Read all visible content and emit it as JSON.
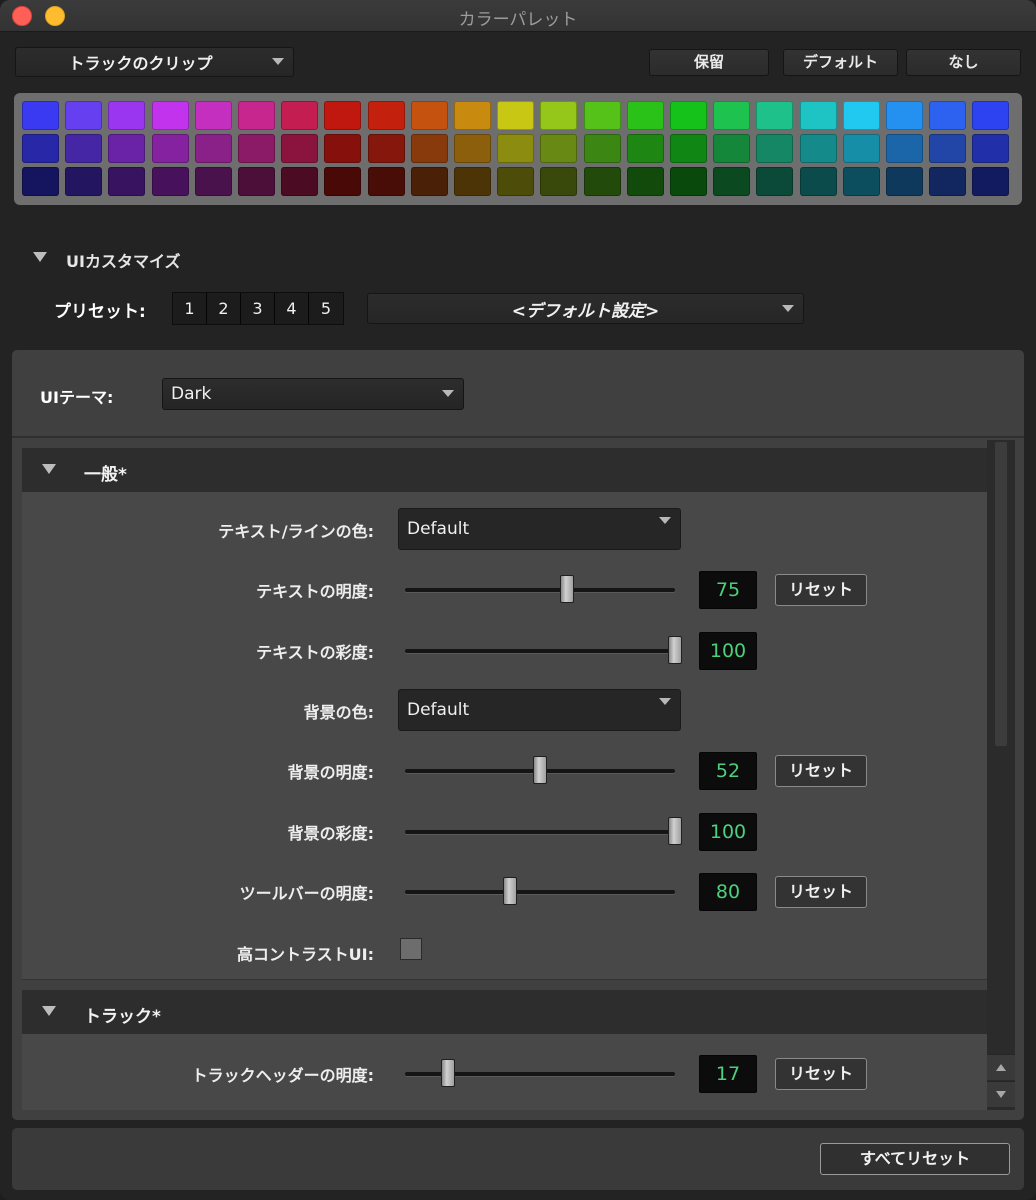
{
  "window": {
    "title": "カラーパレット"
  },
  "toolbar": {
    "clip_combo": "トラックのクリップ",
    "hold_label": "保留",
    "default_label": "デフォルト",
    "none_label": "なし"
  },
  "palette": {
    "rows": [
      [
        "#3a3af2",
        "#6640f0",
        "#9a36f0",
        "#c233ee",
        "#c52fbf",
        "#c8268f",
        "#c31d52",
        "#c0170f",
        "#c3200e",
        "#c5530f",
        "#c88a0f",
        "#c8c814",
        "#95c71a",
        "#55c21a",
        "#2ac218",
        "#15c21a",
        "#1ec24f",
        "#1ec18a",
        "#1ec3c3",
        "#21c9f0",
        "#2490f0",
        "#2d62f0",
        "#2d43f2"
      ],
      [
        "#2727a8",
        "#4527a6",
        "#6a22a6",
        "#84229f",
        "#8a2188",
        "#8b1b66",
        "#8a143d",
        "#86110c",
        "#86170c",
        "#883a0c",
        "#8b5f0c",
        "#8c8c10",
        "#688a14",
        "#3c8714",
        "#1e8713",
        "#108714",
        "#15873a",
        "#158764",
        "#158a8a",
        "#178ea8",
        "#1a66a8",
        "#2146a8",
        "#2130a8"
      ],
      [
        "#15145e",
        "#241560",
        "#371360",
        "#47125b",
        "#4a124c",
        "#4b0f39",
        "#4b0b22",
        "#490907",
        "#490d07",
        "#4a2007",
        "#4c3407",
        "#4d4d09",
        "#39490b",
        "#214a0b",
        "#114a0b",
        "#09490b",
        "#0b4a20",
        "#0b4a38",
        "#0b4b4b",
        "#0c4e5d",
        "#0f385d",
        "#122760",
        "#121b5f"
      ]
    ]
  },
  "ui_customize": {
    "header": "UIカスタマイズ",
    "preset_label": "プリセット:",
    "preset_buttons": [
      "1",
      "2",
      "3",
      "4",
      "5"
    ],
    "preset_value": "<デフォルト設定>"
  },
  "theme": {
    "label": "UIテーマ:",
    "value": "Dark"
  },
  "general": {
    "header": "一般*",
    "text_color_label": "テキスト/ラインの色:",
    "text_color_value": "Default",
    "text_brightness_label": "テキストの明度:",
    "text_brightness_value": "75",
    "text_saturation_label": "テキストの彩度:",
    "text_saturation_value": "100",
    "bg_color_label": "背景の色:",
    "bg_color_value": "Default",
    "bg_brightness_label": "背景の明度:",
    "bg_brightness_value": "52",
    "bg_saturation_label": "背景の彩度:",
    "bg_saturation_value": "100",
    "toolbar_brightness_label": "ツールバーの明度:",
    "toolbar_brightness_value": "80",
    "high_contrast_label": "高コントラストUI:",
    "reset_label": "リセット"
  },
  "track": {
    "header": "トラック*",
    "header_brightness_label": "トラックヘッダーの明度:",
    "header_brightness_value": "17",
    "reset_label": "リセット"
  },
  "sliders": {
    "text_brightness": 0.6,
    "text_saturation": 1.0,
    "bg_brightness": 0.5,
    "bg_saturation": 1.0,
    "toolbar_brightness": 0.39,
    "track_header_brightness": 0.16
  },
  "footer": {
    "reset_all_label": "すべてリセット"
  },
  "colors": {
    "value_green": "#4cd07d",
    "panel": "#404040",
    "section_header": "#2d2d2d"
  }
}
